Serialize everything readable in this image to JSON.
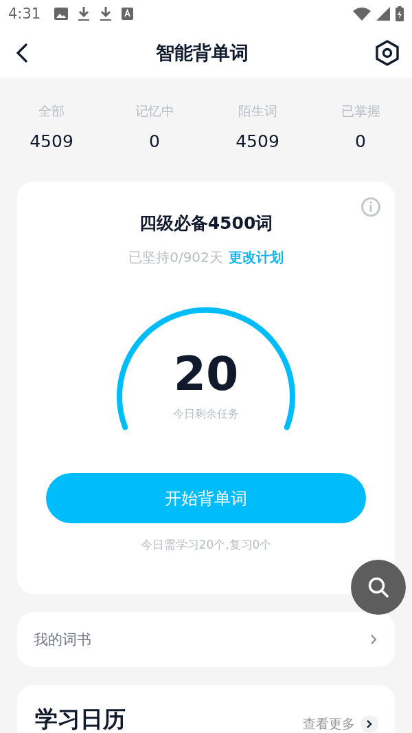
{
  "status_bar": {
    "time": "4:31"
  },
  "header": {
    "title": "智能背单词"
  },
  "stats": [
    {
      "label": "全部",
      "value": "4509"
    },
    {
      "label": "记忆中",
      "value": "0"
    },
    {
      "label": "陌生词",
      "value": "4509"
    },
    {
      "label": "已掌握",
      "value": "0"
    }
  ],
  "plan_card": {
    "title": "四级必备4500词",
    "progress": "已坚持0/902天",
    "change_link": "更改计划",
    "count": "20",
    "count_label": "今日剩余任务",
    "start_button": "开始背单词",
    "note": "今日需学习20个,复习0个"
  },
  "book_row": {
    "label": "我的词书"
  },
  "calendar": {
    "title": "学习日历",
    "more": "查看更多"
  }
}
